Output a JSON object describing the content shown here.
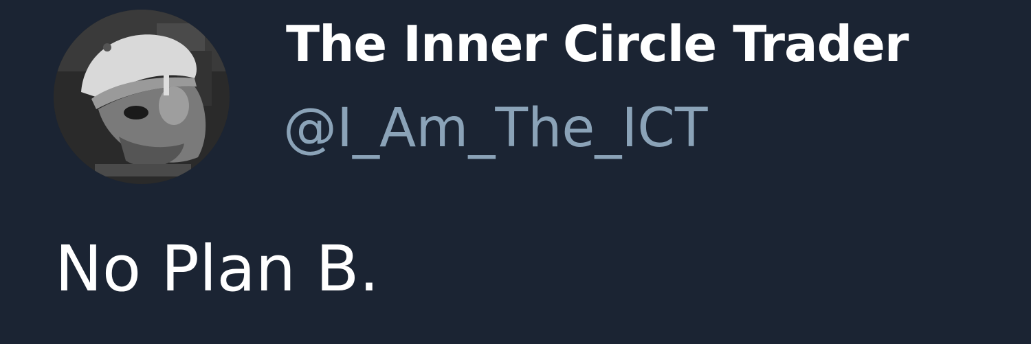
{
  "author": {
    "display_name": "The Inner Circle Trader",
    "handle": "@I_Am_The_ICT",
    "avatar_icon": "profile-photo"
  },
  "tweet": {
    "text": "No Plan B."
  },
  "colors": {
    "background": "#1b2433",
    "display_name": "#ffffff",
    "handle": "#8ba3b8",
    "tweet_text": "#ffffff"
  }
}
